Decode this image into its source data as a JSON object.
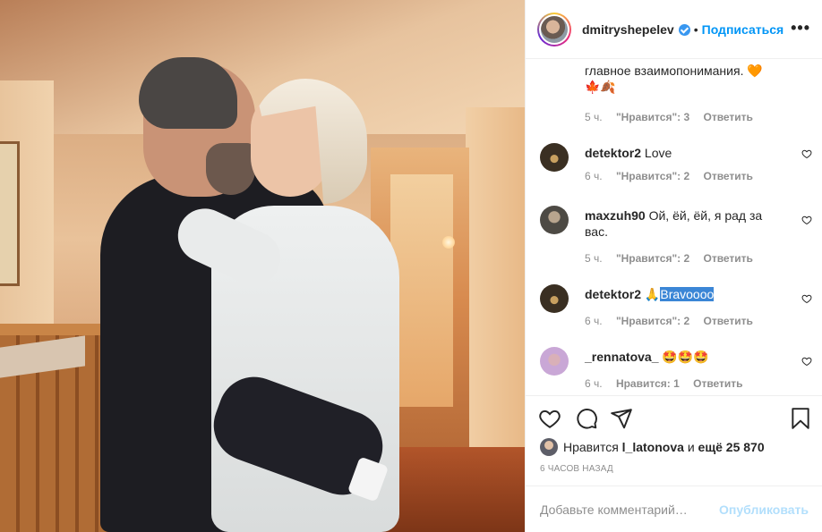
{
  "header": {
    "username": "dmitryshepelev",
    "separator": "•",
    "follow_label": "Подписаться",
    "more_label": "•••"
  },
  "comments": [
    {
      "text": "главное взаимопонимания.",
      "emoji_line1": "🧡",
      "emoji_line2": "🍁🍂",
      "time": "5 ч.",
      "likes": "\"Нравится\": 3",
      "reply": "Ответить"
    },
    {
      "user": "detektor2",
      "text": "Love",
      "time": "6 ч.",
      "likes": "\"Нравится\": 2",
      "reply": "Ответить"
    },
    {
      "user": "maxzuh90",
      "text": "Ой, ёй, ёй, я рад за вас.",
      "time": "5 ч.",
      "likes": "\"Нравится\": 2",
      "reply": "Ответить"
    },
    {
      "user": "detektor2",
      "emoji": "🙏",
      "text": "Bravoooo",
      "time": "6 ч.",
      "likes": "\"Нравится\": 2",
      "reply": "Ответить"
    },
    {
      "user": "_rennatova_",
      "text": "🤩🤩🤩",
      "time": "6 ч.",
      "likes": "Нравится: 1",
      "reply": "Ответить"
    }
  ],
  "actions": {
    "like_icon": "heart-icon",
    "comment_icon": "comment-icon",
    "share_icon": "share-icon",
    "save_icon": "bookmark-icon"
  },
  "likes": {
    "prefix": "Нравится",
    "user": "l_latonova",
    "and": "и",
    "count": "ещё 25 870"
  },
  "time_ago": "6 часов назад",
  "add_comment": {
    "placeholder": "Добавьте комментарий…",
    "publish_label": "Опубликовать"
  },
  "colors": {
    "accent": "#0095f6",
    "publish_disabled": "#b2dffc",
    "meta_grey": "#8e8e8e"
  }
}
